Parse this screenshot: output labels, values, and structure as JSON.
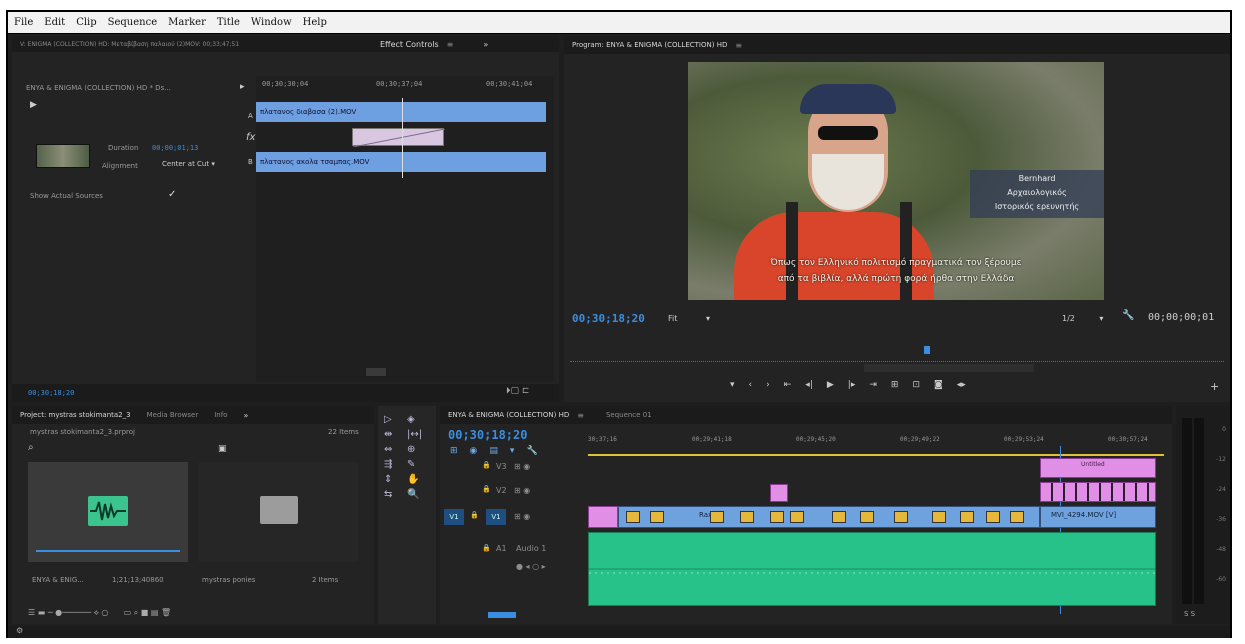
{
  "menu": [
    "File",
    "Edit",
    "Clip",
    "Sequence",
    "Marker",
    "Title",
    "Window",
    "Help"
  ],
  "effect_controls": {
    "source_tab": "V: ENIGMA (COLLECTION) HD: Μεταβίβαση παλαιού (2)ΜΟV: 00;33;47;51",
    "tab": "Effect Controls",
    "clip_title": "ENYA & ENIGMA (COLLECTION) HD * Ds...",
    "times": [
      "00;30;30;04",
      "00;30;37;04",
      "00;30;41;04"
    ],
    "clip_a": "πλατανος διαβασα (2).MOV",
    "clip_b": "πλατανος ακολα τσαμπας.MOV",
    "duration_label": "Duration",
    "duration_value": "00;00;01;13",
    "alignment_label": "Alignment",
    "alignment_value": "Center at Cut",
    "show_actual_label": "Show Actual Sources",
    "timecode": "00;30;18;20",
    "letter_a": "A",
    "letter_b": "B",
    "fx": "fx",
    "play_glyph": "▶",
    "check_glyph": "✓",
    "dropdown_glyph": "▾",
    "tab_menu_glyph": "≡",
    "more_glyph": "»",
    "right_glyph": "▸",
    "footer_icons": "⏵▢ ⊏"
  },
  "program": {
    "tab": "Program: ENYA & ENIGMA (COLLECTION) HD",
    "timecode": "00;30;18;20",
    "fit": "Fit",
    "quality": "1/2",
    "duration": "00;00;00;01",
    "overlay_name": "Bernhard",
    "overlay_role1": "Αρχαιολογικός",
    "overlay_role2": "Ιστορικός ερευνητής",
    "subtitle1": "Όπως τον Ελληνικό πολιτισμό πραγματικά τον ξέρουμε",
    "subtitle2": "από τα βιβλία, αλλά πρώτη φορά ήρθα στην Ελλάδα",
    "controls": [
      "▾",
      "‹",
      "›",
      "⇤",
      "◂|",
      "▶",
      "|▸",
      "⇥",
      "⊞",
      "⊡",
      "◙",
      "◂▸"
    ],
    "add_btn": "+",
    "tab_menu_glyph": "≡",
    "dropdown_glyph": "▾",
    "wrench_glyph": "🔧"
  },
  "project": {
    "tab": "Project: mystras stokimanta2_3",
    "tab2": "Media Browser",
    "tab3": "Info",
    "more_glyph": "»",
    "file": "mystras stokimanta2_3.prproj",
    "items_count": "22 Items",
    "search_glyph": "⌕",
    "folder_glyph": "▣",
    "item1_name": "ENYA & ENIG...",
    "item1_dur": "1;21;13;40860",
    "item2_name": "mystras ponies",
    "item2_count": "2 Items",
    "footer_icons": "☰ ▬ ─ ●────── ⟡ ○      ▭ ⌕ ■ ▤ 🗑"
  },
  "tools": [
    "▷",
    "◈",
    "⇹",
    "|↔|",
    "⇔",
    "⊕",
    "⇶",
    "✎",
    "⇕",
    "✋",
    "⇆",
    "🔍"
  ],
  "timeline": {
    "tab1": "ENYA & ENIGMA (COLLECTION) HD",
    "tab2": "Sequence 01",
    "close_glyph": "≡",
    "timecode": "00;30;18;20",
    "ruler": [
      "30;37;16",
      "00;29;41;18",
      "00;29;45;20",
      "00;29;49;22",
      "00;29;53;24",
      "00;30;57;24"
    ],
    "tracks": [
      {
        "name": "V3"
      },
      {
        "name": "V2"
      },
      {
        "name": "V1"
      },
      {
        "name": "A1",
        "label": "Audio 1"
      }
    ],
    "v1_src": "V1",
    "clip_v3_label": "Untitled",
    "clip_v1_end": "MVI_4294.MOV [V]",
    "clip_rax": "Rax",
    "fx": "fx",
    "toolbar_icons": [
      "⊞",
      "◉",
      "▤",
      "▾",
      "🔧"
    ],
    "track_ctrl_icons": "⊞ ◉",
    "audio_ctrl_icons": "● ◂ ○ ▸",
    "lock_glyph": "🔒"
  },
  "meter": {
    "ticks": [
      "0",
      "-12",
      "-24",
      "-36",
      "-48",
      "-60"
    ],
    "bottom": "S S"
  },
  "statusbar": {
    "icon": "⚙"
  }
}
